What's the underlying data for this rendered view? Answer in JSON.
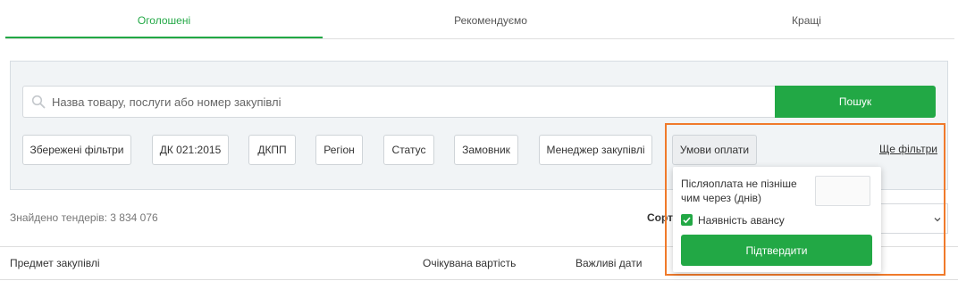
{
  "tabs": [
    {
      "label": "Оголошені",
      "active": true
    },
    {
      "label": "Рекомендуємо",
      "active": false
    },
    {
      "label": "Кращі",
      "active": false
    }
  ],
  "search": {
    "placeholder": "Назва товару, послуги або номер закупівлі",
    "button_label": "Пошук"
  },
  "filters": [
    "Збережені фільтри",
    "ДК 021:2015",
    "ДКПП",
    "Регіон",
    "Статус",
    "Замовник",
    "Менеджер закупівлі",
    "Умови оплати"
  ],
  "more_filters_label": "Ще фільтри",
  "payment_popover": {
    "postpay_label": "Післяоплата не пізніше чим через (днів)",
    "postpay_value": "",
    "advance_label": "Наявність авансу",
    "advance_checked": true,
    "confirm_label": "Підтвердити"
  },
  "results": {
    "found_text": "Знайдено тендерів: 3 834 076",
    "sort_label": "Сорт"
  },
  "table_headers": [
    "Предмет закупівлі",
    "Очікувана вартість",
    "Важливі дати"
  ],
  "colors": {
    "accent": "#22a845",
    "highlight": "#f07a2b"
  }
}
